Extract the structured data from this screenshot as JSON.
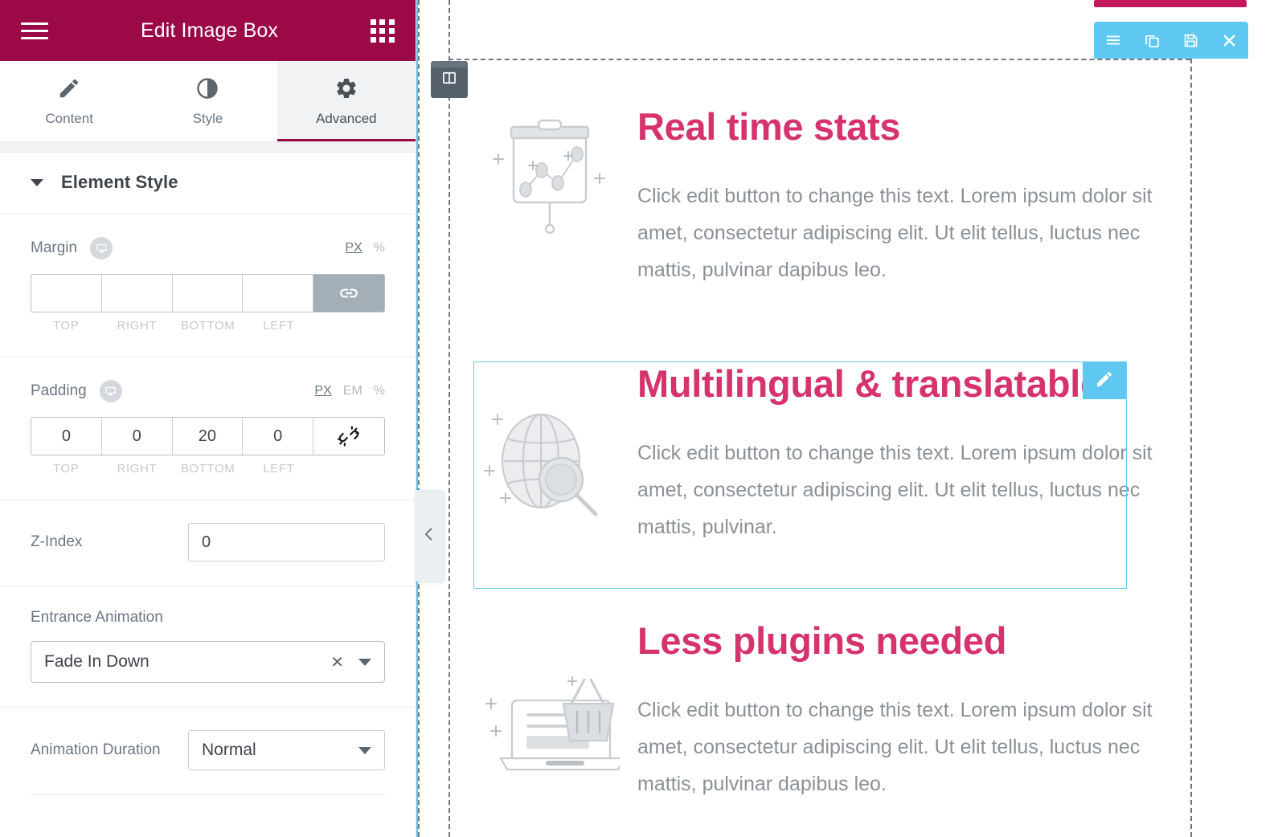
{
  "panel": {
    "header": {
      "title": "Edit Image Box",
      "menu_icon": "hamburger-icon",
      "widgets_icon": "grid-widgets-icon"
    },
    "tabs": [
      {
        "label": "Content",
        "icon": "pencil-icon",
        "active": false
      },
      {
        "label": "Style",
        "icon": "contrast-icon",
        "active": false
      },
      {
        "label": "Advanced",
        "icon": "gear-icon",
        "active": true
      }
    ],
    "section": {
      "title": "Element Style",
      "expanded": true
    },
    "margin": {
      "label": "Margin",
      "responsive_icon": "desktop-icon",
      "units": [
        {
          "label": "PX",
          "active": true
        },
        {
          "label": "%",
          "active": false
        }
      ],
      "values": {
        "top": "",
        "right": "",
        "bottom": "",
        "left": ""
      },
      "labels": {
        "top": "TOP",
        "right": "RIGHT",
        "bottom": "BOTTOM",
        "left": "LEFT"
      },
      "link_state": "linked",
      "link_icon": "link-icon"
    },
    "padding": {
      "label": "Padding",
      "responsive_icon": "desktop-icon",
      "units": [
        {
          "label": "PX",
          "active": true
        },
        {
          "label": "EM",
          "active": false
        },
        {
          "label": "%",
          "active": false
        }
      ],
      "values": {
        "top": "0",
        "right": "0",
        "bottom": "20",
        "left": "0"
      },
      "labels": {
        "top": "TOP",
        "right": "RIGHT",
        "bottom": "BOTTOM",
        "left": "LEFT"
      },
      "link_state": "unlinked",
      "link_icon": "broken-link-icon"
    },
    "z_index": {
      "label": "Z-Index",
      "value": "0",
      "placeholder": "0"
    },
    "entrance_animation": {
      "label": "Entrance Animation",
      "value": "Fade In Down",
      "clear_icon": "close-x-icon",
      "caret_icon": "chevron-down-icon"
    },
    "animation_duration": {
      "label": "Animation Duration",
      "value": "Normal",
      "caret_icon": "chevron-down-icon"
    }
  },
  "canvas": {
    "column_handle_icon": "column-layout-icon",
    "collapse_handle_icon": "chevron-left-icon",
    "widget_toolbar": [
      {
        "icon": "drag-handle-icon",
        "name": "edit-section-handle"
      },
      {
        "icon": "duplicate-icon",
        "name": "duplicate-section"
      },
      {
        "icon": "save-icon",
        "name": "save-section"
      },
      {
        "icon": "close-x-icon",
        "name": "remove-section"
      }
    ],
    "edit_badge_icon": "pencil-icon",
    "blocks": [
      {
        "heading": "Real time stats",
        "body": "Click edit button to change this text. Lorem ipsum dolor sit amet, consectetur adipiscing elit. Ut elit tellus, luctus nec mattis, pulvinar dapibus leo.",
        "icon": "presentation-chart-icon",
        "selected": false
      },
      {
        "heading": "Multilingual & translatable",
        "body": "Click edit button to change this text. Lorem ipsum dolor sit amet, consectetur adipiscing elit. Ut elit tellus, luctus nec mattis, pulvinar.",
        "icon": "globe-search-icon",
        "selected": true
      },
      {
        "heading": "Less plugins needed",
        "body": "Click edit button to change this text. Lorem ipsum dolor sit amet, consectetur adipiscing elit. Ut elit tellus, luctus nec mattis, pulvinar dapibus leo.",
        "icon": "laptop-basket-icon",
        "selected": false
      }
    ]
  },
  "colors": {
    "panel_header": "#9B0A46",
    "heading_pink": "#D6336C",
    "toolbar_blue": "#5EC8F2",
    "selection_blue": "#62CBF2",
    "body_gray": "#8B9197"
  }
}
